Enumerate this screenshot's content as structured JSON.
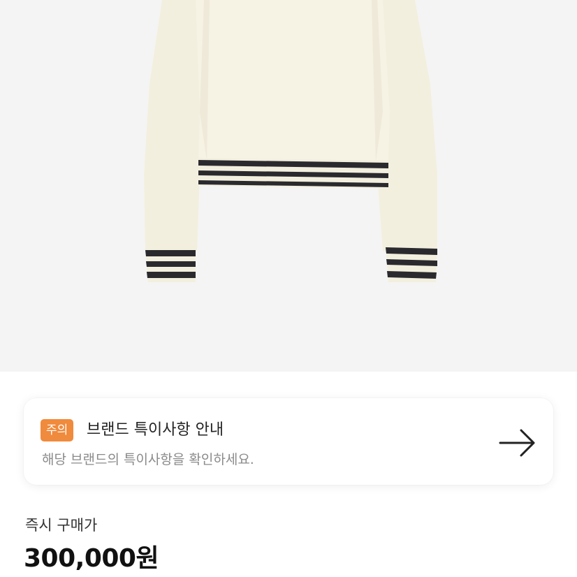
{
  "product": {
    "image_icon": "sweater-product-image",
    "colors": {
      "background": "#f4f4f4",
      "sweater": "#f3efdf",
      "stripe_dark": "#2a2a2e"
    }
  },
  "notice": {
    "badge": "주의",
    "title": "브랜드 특이사항 안내",
    "description": "해당 브랜드의 특이사항을 확인하세요.",
    "arrow_icon": "arrow-right-icon",
    "badge_color": "#f08a3c"
  },
  "price": {
    "label": "즉시 구매가",
    "value": "300,000원"
  }
}
